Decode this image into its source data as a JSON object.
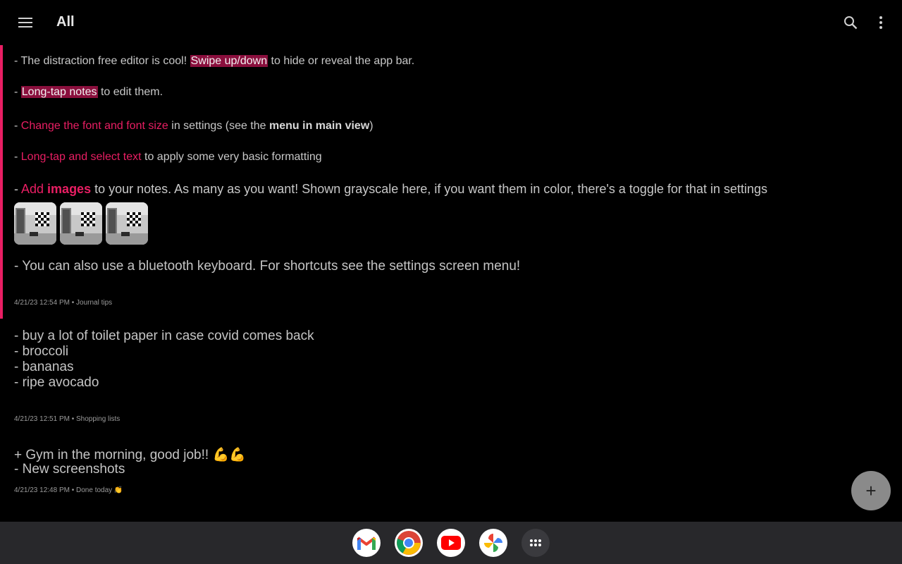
{
  "appbar": {
    "title": "All",
    "menu_icon": "hamburger-menu-icon",
    "search_icon": "search-icon",
    "more_icon": "more-vertical-icon"
  },
  "notes": [
    {
      "lines": {
        "l1_a": "- The distraction free editor is cool! ",
        "l1_hl": "Swipe up/down",
        "l1_b": " to hide or reveal the app bar.",
        "l2_a": "- ",
        "l2_hl": "Long-tap notes",
        "l2_b": " to edit them.",
        "l3_a": "- ",
        "l3_pink": "Change the font and font size",
        "l3_b": " in settings (see the ",
        "l3_bold": "menu in main view",
        "l3_c": ")",
        "l4_a": "- ",
        "l4_pink": "Long-tap and select text",
        "l4_b": " to apply some very basic formatting",
        "l5_a": "- ",
        "l5_pink": "Add ",
        "l5_pinkbold": "images",
        "l5_b": " to your notes. As many as you want! Shown grayscale here, if you want them in color, there's a toggle for that in settings",
        "l6": "- You can also use a bluetooth keyboard. For shortcuts see the settings screen menu!"
      },
      "image_count": 3,
      "meta": "4/21/23 12:54 PM • Journal tips"
    },
    {
      "lines": [
        "- buy a lot of toilet paper in case covid comes back",
        "- broccoli",
        "- bananas",
        "- ripe avocado"
      ],
      "meta": "4/21/23 12:51 PM • Shopping lists"
    },
    {
      "lines": [
        "+ Gym in the morning, good job!! 💪💪",
        "- New screenshots"
      ],
      "meta": "4/21/23 12:48 PM • Done today 👏"
    }
  ],
  "fab": {
    "label": "+",
    "icon": "add-icon"
  },
  "dock": {
    "apps": [
      "Gmail",
      "Chrome",
      "YouTube",
      "Photos",
      "App drawer"
    ]
  },
  "colors": {
    "accent": "#e91e63",
    "highlight_bg": "#8a0f3d",
    "background": "#000000",
    "dock_bg": "#28282b"
  }
}
